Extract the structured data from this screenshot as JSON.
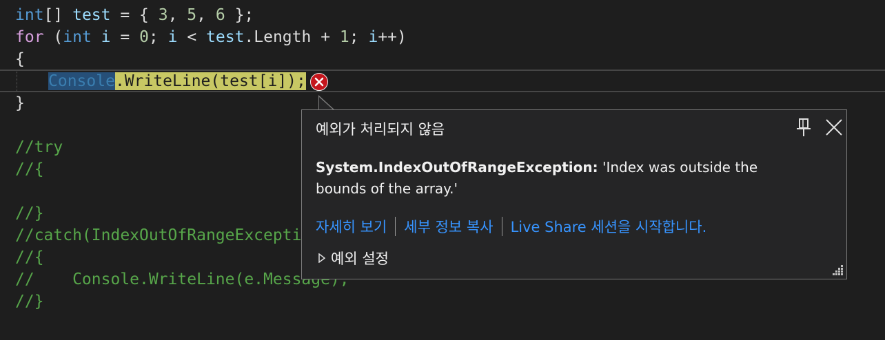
{
  "code": {
    "line1": {
      "kw": "int",
      "rest1": "[] ",
      "ident": "test",
      "rest2": " = { ",
      "n1": "3",
      "c1": ", ",
      "n2": "5",
      "c2": ", ",
      "n3": "6",
      "rest3": " };"
    },
    "line2": {
      "kw_for": "for",
      "p1": " (",
      "kw_int": "int",
      "sp": " ",
      "i1": "i",
      "eq": " = ",
      "zero": "0",
      "semi1": "; ",
      "i2": "i",
      "lt": " < ",
      "test": "test",
      "len": ".Length + ",
      "one": "1",
      "semi2": "; ",
      "i3": "i",
      "pp": "++)"
    },
    "line3": "{",
    "line4": {
      "console": "Console",
      "stmt": ".WriteLine(test[i]);"
    },
    "line5": "}",
    "comments": [
      "//try",
      "//{",
      "//}",
      "//catch(IndexOutOfRangeException",
      "//{",
      "//    Console.WriteLine(e.Message);",
      "//}"
    ]
  },
  "popup": {
    "title": "예외가 처리되지 않음",
    "exception_type": "System.IndexOutOfRangeException:",
    "exception_message": " 'Index was outside the bounds of the array.'",
    "links": [
      "자세히 보기",
      "세부 정보 복사",
      "Live Share 세션을 시작합니다."
    ],
    "settings_label": "예외 설정"
  },
  "icons": {
    "error": "error-circle-icon",
    "pin": "pin-icon",
    "close": "close-icon",
    "expand": "triangle-right-icon",
    "resize": "resize-grip-icon"
  },
  "colors": {
    "background": "#1e1e1e",
    "keyword": "#569cd6",
    "control": "#d8a0df",
    "number": "#b5cea8",
    "comment": "#57a64a",
    "link": "#3794ff",
    "error": "#c5161d",
    "statement_highlight": "#c8c864",
    "selection": "#264f78"
  }
}
